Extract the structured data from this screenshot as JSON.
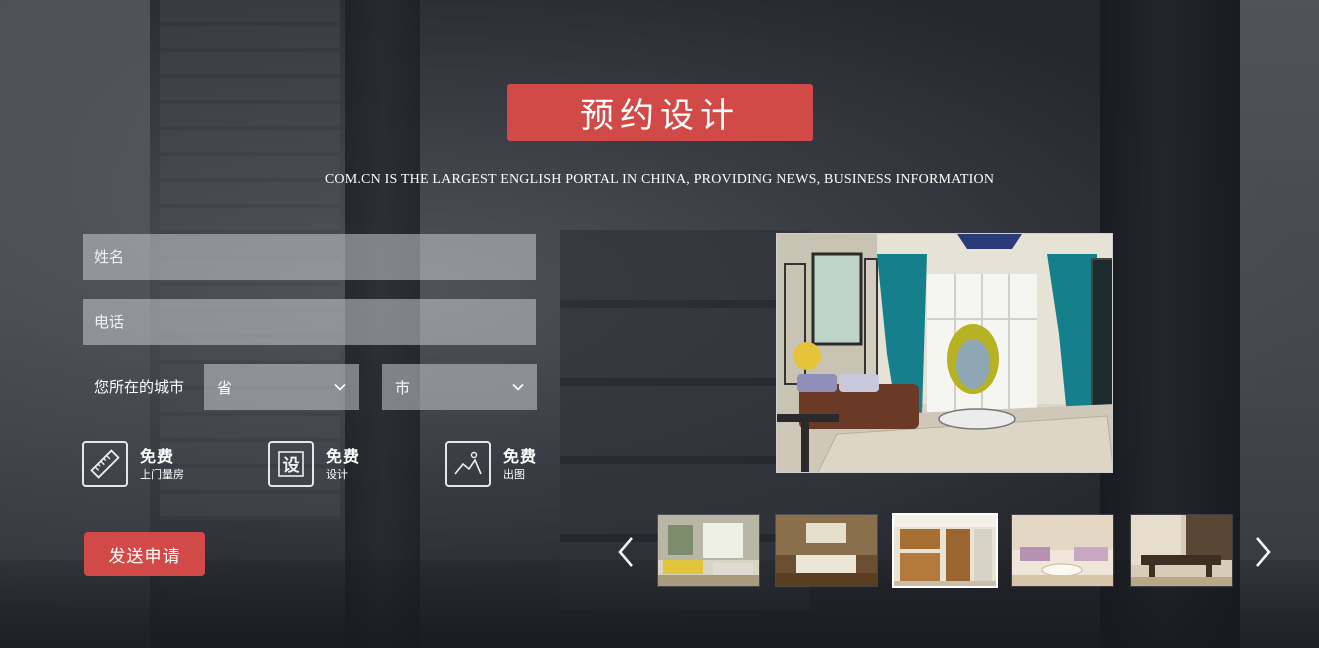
{
  "title": "预约设计",
  "subtitle": "COM.CN IS THE LARGEST ENGLISH PORTAL IN CHINA, PROVIDING NEWS, BUSINESS INFORMATION",
  "form": {
    "name_placeholder": "姓名",
    "phone_placeholder": "电话",
    "city_label": "您所在的城市",
    "province_select": "省",
    "city_select": "市",
    "submit_label": "发送申请"
  },
  "features": [
    {
      "big": "免费",
      "small": "上门量房",
      "icon": "ruler-icon"
    },
    {
      "big": "免费",
      "small": "设计",
      "icon": "design-icon"
    },
    {
      "big": "免费",
      "small": "出图",
      "icon": "image-icon"
    }
  ],
  "gallery": {
    "active_index": 2,
    "thumbs": [
      "living-room-thumb",
      "bedroom-thumb",
      "kitchen-thumb",
      "lounge-thumb",
      "dining-thumb"
    ]
  },
  "colors": {
    "accent": "#d14a47",
    "field_bg": "#c8cad0",
    "text": "#ffffff"
  }
}
